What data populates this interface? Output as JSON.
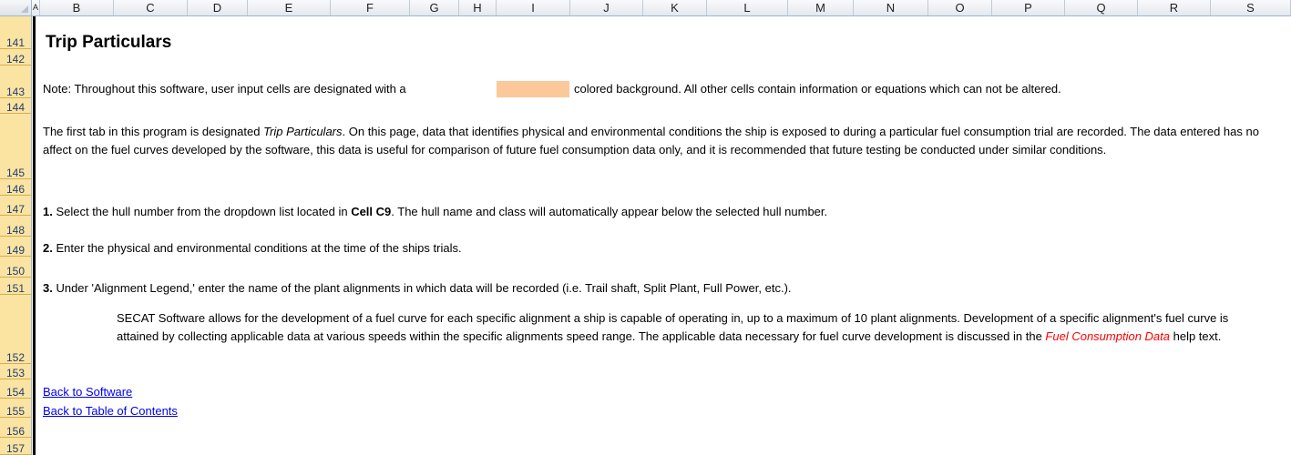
{
  "sheet": {
    "columns": [
      "A",
      "B",
      "C",
      "D",
      "E",
      "F",
      "G",
      "H",
      "I",
      "J",
      "K",
      "L",
      "M",
      "N",
      "O",
      "P",
      "Q",
      "R",
      "S"
    ],
    "rows": [
      "141",
      "142",
      "143",
      "144",
      "145",
      "146",
      "147",
      "148",
      "149",
      "150",
      "151",
      "152",
      "153",
      "154",
      "155",
      "156",
      "157"
    ]
  },
  "content": {
    "title": "Trip Particulars",
    "note_prefix": "Note:  Throughout this software, user input cells are designated with a",
    "note_suffix": "colored background.  All other cells contain information or equations which can not be altered.",
    "input_color": "#fbc89a",
    "intro_a": "The first tab in this program is designated ",
    "intro_italic": "Trip Particulars",
    "intro_b": ".  On this page, data that identifies physical and environmental conditions the ship is exposed to during a particular fuel consumption trial are recorded.  The data entered has no affect on the fuel curves developed by the software, this data is useful for comparison of future fuel consumption data only, and it is recommended that future testing be conducted under similar conditions.",
    "step1_num": "1.",
    "step1_a": "  Select the hull number from the dropdown list located in ",
    "step1_bold": "Cell C9",
    "step1_b": ".  The hull name and class will automatically appear below the selected hull number.",
    "step2_num": "2.",
    "step2_text": "  Enter the physical and environmental conditions at the time of the ships trials.",
    "step3_num": "3.",
    "step3_text": "  Under 'Alignment Legend,' enter the name of the plant alignments in which data will be recorded (i.e. Trail shaft, Split Plant, Full Power, etc.).",
    "secat_a": "SECAT Software allows for the development of a fuel curve for each specific alignment a ship is capable of operating in, up to a maximum of 10 plant alignments.  Development of a specific alignment's fuel curve is attained by collecting applicable data at various speeds within the specific alignments speed range.  The applicable data necessary for fuel curve development is discussed in the ",
    "secat_link": "Fuel Consumption Data",
    "secat_b": "  help text.",
    "link_software": "Back to Software",
    "link_toc": "Back to Table of Contents"
  }
}
